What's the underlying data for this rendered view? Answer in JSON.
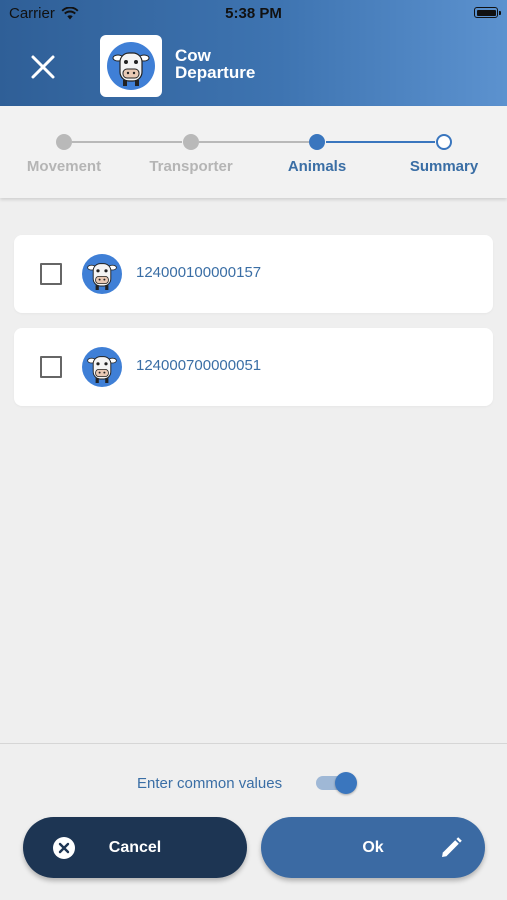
{
  "status_bar": {
    "carrier": "Carrier",
    "time": "5:38 PM"
  },
  "header": {
    "title_line1": "Cow",
    "title_line2": "Departure",
    "logo_icon": "cow-icon",
    "close_icon": "close-icon"
  },
  "stepper": {
    "steps": [
      {
        "label": "Movement",
        "state": "done"
      },
      {
        "label": "Transporter",
        "state": "done"
      },
      {
        "label": "Animals",
        "state": "active"
      },
      {
        "label": "Summary",
        "state": "pending"
      }
    ]
  },
  "animals": [
    {
      "id": "124000100000157",
      "checked": false
    },
    {
      "id": "124000700000051",
      "checked": false
    }
  ],
  "footer": {
    "common_values_label": "Enter common values",
    "common_values_enabled": true,
    "cancel_label": "Cancel",
    "ok_label": "Ok"
  },
  "colors": {
    "header_start": "#2f5f97",
    "header_end": "#5c92cf",
    "accent": "#3a76be",
    "inactive_step": "#b9b9b9",
    "cancel_button": "#1d3553",
    "ok_button": "#3b6aa3"
  }
}
